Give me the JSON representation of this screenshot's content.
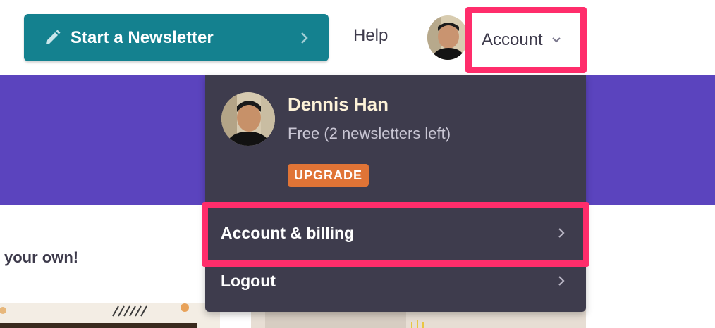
{
  "header": {
    "start_newsletter_label": "Start a Newsletter",
    "help_label": "Help",
    "account_label": "Account"
  },
  "account_menu": {
    "user_name": "Dennis Han",
    "plan_text": "Free (2 newsletters left)",
    "upgrade_label": "UPGRADE",
    "items": [
      {
        "label": "Account & billing"
      },
      {
        "label": "Logout"
      }
    ]
  },
  "page": {
    "partial_heading": "your own!"
  },
  "icons": {
    "start_button": "pencil-icon",
    "chevron": "chevron-right-icon",
    "account_chevron": "chevron-down-icon"
  },
  "colors": {
    "primary_button": "#14818f",
    "banner": "#5b44be",
    "dropdown_bg": "#3e3c4d",
    "upgrade_badge": "#e07436",
    "highlight": "#ff2d6b",
    "user_name": "#fdf2d8"
  }
}
